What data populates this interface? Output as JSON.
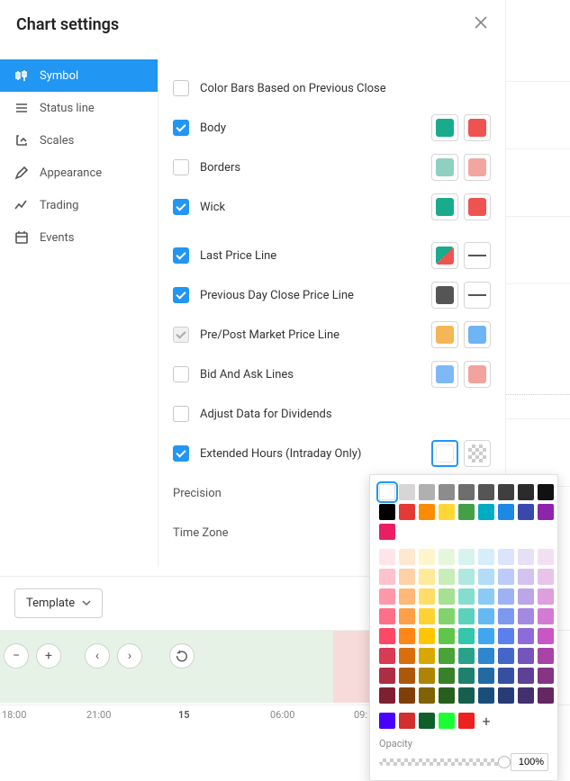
{
  "dialog": {
    "title": "Chart settings"
  },
  "sidebar": {
    "items": [
      {
        "label": "Symbol"
      },
      {
        "label": "Status line"
      },
      {
        "label": "Scales"
      },
      {
        "label": "Appearance"
      },
      {
        "label": "Trading"
      },
      {
        "label": "Events"
      }
    ]
  },
  "settings": {
    "color_bars_on_prev_close": {
      "label": "Color Bars Based on Previous Close",
      "checked": false
    },
    "body": {
      "label": "Body",
      "checked": true,
      "upColor": "#1aaa8c",
      "downColor": "#ef5350"
    },
    "borders": {
      "label": "Borders",
      "checked": false,
      "upColor": "#8fd0c0",
      "downColor": "#f3a6a0"
    },
    "wick": {
      "label": "Wick",
      "checked": true,
      "upColor": "#1aaa8c",
      "downColor": "#ef5350"
    },
    "last_price": {
      "label": "Last Price Line",
      "checked": true,
      "upColor": "#1aaa8c",
      "downColor": "#ef5350"
    },
    "prev_close": {
      "label": "Previous Day Close Price Line",
      "checked": true,
      "color": "#555555"
    },
    "pre_post": {
      "label": "Pre/Post Market Price Line",
      "checked": true,
      "upColor": "#f4b656",
      "downColor": "#6fb4f4"
    },
    "bid_ask": {
      "label": "Bid And Ask Lines",
      "checked": false,
      "upColor": "#7fb8f6",
      "downColor": "#f2a39e"
    },
    "adjust_div": {
      "label": "Adjust Data for Dividends",
      "checked": false
    },
    "ext_hours": {
      "label": "Extended Hours (Intraday Only)",
      "checked": true,
      "color1": "#ffffff"
    },
    "precision": {
      "label": "Precision"
    },
    "time_zone": {
      "label": "Time Zone"
    }
  },
  "footer": {
    "template_label": "Template"
  },
  "color_picker": {
    "opacity_label": "Opacity",
    "opacity_value": "100%",
    "selected": "#ffffff",
    "palette_main": [
      "#ffffff",
      "#d6d6d6",
      "#b0b0b0",
      "#8c8c8c",
      "#6e6e6e",
      "#555555",
      "#3f3f3f",
      "#2b2b2b",
      "#111111",
      "#000000",
      "#e53935",
      "#fb8c00",
      "#fdd835",
      "#43a047",
      "#00acc1",
      "#1e88e5",
      "#3949ab",
      "#8e24aa",
      "#e91e63"
    ],
    "palette_tints": [
      "#ffe5ea",
      "#ffe7d1",
      "#fff5cc",
      "#e6f6dc",
      "#d6f3ee",
      "#d6edfb",
      "#dbe4fb",
      "#e7dff6",
      "#f3dff2",
      "#ffc1cc",
      "#ffd1a6",
      "#ffea99",
      "#c8edb8",
      "#aee8de",
      "#b2dcf8",
      "#bccbf7",
      "#d2c3ef",
      "#e9c3ea",
      "#ff99aa",
      "#ffb877",
      "#ffdd66",
      "#a5e093",
      "#85ddcd",
      "#8ccaf5",
      "#9cb2f3",
      "#bba6e8",
      "#de9fde",
      "#ff7088",
      "#ff9f47",
      "#ffd233",
      "#82d36e",
      "#5cd2bc",
      "#66b8f2",
      "#7c99ef",
      "#a489e1",
      "#d37bd2",
      "#ff4766",
      "#ff8617",
      "#ffc600",
      "#5fc64c",
      "#33c7ab",
      "#40a6ef",
      "#5c80eb",
      "#8d6cda",
      "#c857c6",
      "#d93a54",
      "#d96e0f",
      "#d9a800",
      "#49a338",
      "#28a38a",
      "#2d87cc",
      "#4566c9",
      "#7554bd",
      "#a944a7",
      "#ad2d43",
      "#ad570b",
      "#ad8500",
      "#388129",
      "#1f816d",
      "#236aa2",
      "#3550a1",
      "#5c4197",
      "#863585",
      "#801f31",
      "#803f08",
      "#806200",
      "#285f1d",
      "#165f50",
      "#1a4e78",
      "#273b77",
      "#442f6f",
      "#632762"
    ],
    "palette_custom": [
      "#4a00ff",
      "#d32f2f",
      "#0f5f2a",
      "#1aff33",
      "#ef2020"
    ],
    "add_label": "+"
  },
  "timeline": {
    "ticks": [
      "18:00",
      "21:00",
      "15",
      "06:00",
      "09:"
    ]
  }
}
